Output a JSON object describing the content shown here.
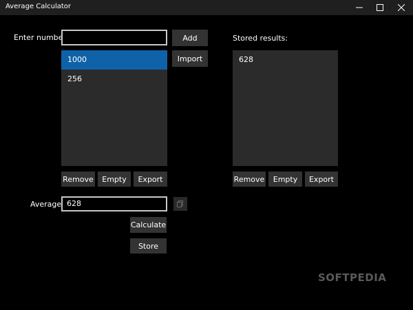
{
  "window": {
    "title": "Average Calculator",
    "controls": [
      "minimize-icon",
      "maximize-icon",
      "close-icon"
    ]
  },
  "input": {
    "label": "Enter number:",
    "value": "",
    "add_label": "Add",
    "import_label": "Import"
  },
  "numbers": {
    "items": [
      "1000",
      "256"
    ],
    "selected": "1000",
    "remove_label": "Remove",
    "empty_label": "Empty",
    "export_label": "Export"
  },
  "average": {
    "label": "Average:",
    "value": "628",
    "copy_icon": "copy-icon",
    "calculate_label": "Calculate",
    "store_label": "Store"
  },
  "stored": {
    "label": "Stored results:",
    "items": [
      "628"
    ],
    "remove_label": "Remove",
    "empty_label": "Empty",
    "export_label": "Export"
  },
  "watermark": "SOFTPEDIA",
  "colors": {
    "background": "#000000",
    "titlebar": "#1f1f1f",
    "button": "#333333",
    "list_background": "#2b2b2b",
    "selection": "#0f62a8"
  }
}
